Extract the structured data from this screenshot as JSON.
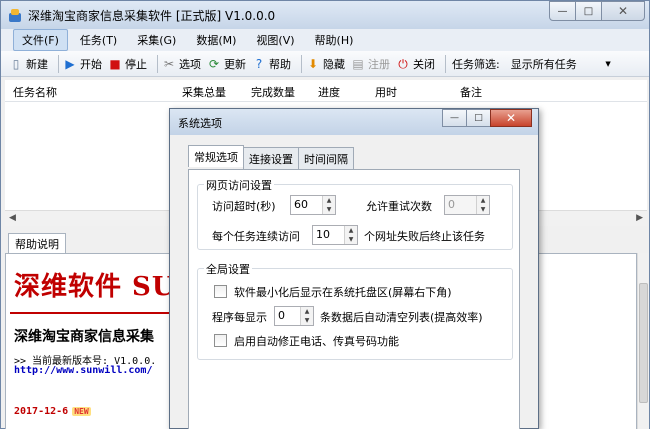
{
  "app": {
    "title": "深维淘宝商家信息采集软件 [正式版] V1.0.0.0",
    "caption_buttons": {
      "minimize": "—",
      "maximize": "□",
      "close": "✕"
    }
  },
  "menu": [
    "文件(F)",
    "任务(T)",
    "采集(G)",
    "数据(M)",
    "视图(V)",
    "帮助(H)"
  ],
  "toolbar": {
    "new": "新建",
    "start": "开始",
    "stop": "停止",
    "options": "选项",
    "update": "更新",
    "help": "帮助",
    "hide": "隐藏",
    "register": "注册",
    "close": "关闭",
    "filter_label": "任务筛选:",
    "filter_value": "显示所有任务"
  },
  "task_list": {
    "columns": [
      "任务名称",
      "采集总量",
      "完成数量",
      "进度",
      "用时",
      "备注"
    ]
  },
  "help": {
    "tab": "帮助说明",
    "brand": "深维软件 SU",
    "title": "深维淘宝商家信息采集",
    "version_line": ">> 当前最新版本号: V1.0.0.",
    "url": "http://www.sunwill.com/",
    "date": "2017-12-6",
    "new_badge": "NEW"
  },
  "dialog": {
    "title": "系统选项",
    "tabs": [
      "常规选项",
      "连接设置",
      "时间间隔"
    ],
    "web_group": {
      "title": "网页访问设置",
      "timeout_label": "访问超时(秒)",
      "timeout_value": "60",
      "retry_label": "允许重试次数",
      "retry_value": "0",
      "consecutive_prefix": "每个任务连续访问",
      "consecutive_value": "10",
      "consecutive_suffix": "个网址失败后终止该任务"
    },
    "global_group": {
      "title": "全局设置",
      "tray_label": "软件最小化后显示在系统托盘区(屏幕右下角)",
      "clear_prefix": "程序每显示",
      "clear_value": "0",
      "clear_suffix": "条数据后自动清空列表(提高效率)",
      "autofix_label": "启用自动修正电话、传真号码功能"
    }
  }
}
